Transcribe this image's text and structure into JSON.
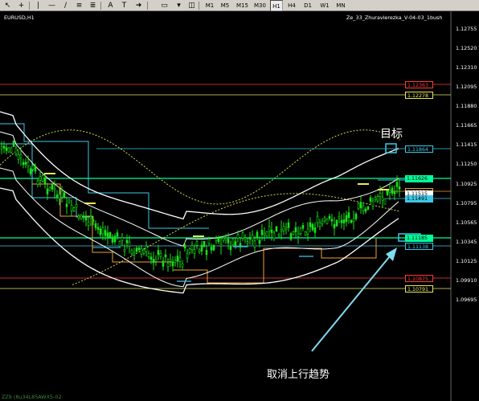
{
  "toolbar": {
    "timeframes": [
      "M1",
      "M5",
      "M15",
      "M30",
      "H1",
      "H4",
      "D1",
      "W1",
      "MN"
    ],
    "active": "H1"
  },
  "chart": {
    "symbol_label": "EURUSD,H1",
    "indicator_label": "Ze_33_Zhuravlerezka_V-04-03_1bush",
    "bottom_label": "ZZ9 (8u34L85AWX5-02"
  },
  "price_axis": {
    "ticks": [
      "1.12755",
      "1.12520",
      "1.12310",
      "1.12095",
      "1.11880",
      "1.11665",
      "1.11415",
      "1.11250",
      "1.10925",
      "1.10795",
      "1.10565",
      "1.10345",
      "1.10125",
      "1.09910",
      "1.09695"
    ]
  },
  "levels": {
    "l1": {
      "price": "1.12363",
      "color": "#ff3b3b"
    },
    "l2": {
      "price": "1.12278",
      "color": "#e8e85a"
    },
    "l3": {
      "price": "1.11864",
      "color": "#3ec7e6"
    },
    "l4": {
      "price": "1.11626",
      "color": "#00ff9a"
    },
    "l5": {
      "price": "1.11534",
      "color": "#f0a030"
    },
    "l6": {
      "price": "1.11515",
      "color": "#ffffff"
    },
    "l7": {
      "price": "1.11491",
      "color": "#3ec7e6"
    },
    "l8": {
      "price": "1.11185",
      "color": "#00ff9a"
    },
    "l9": {
      "price": "1.11138",
      "color": "#3ec7e6"
    },
    "l10": {
      "price": "1.10875",
      "color": "#ff3b3b"
    },
    "l11": {
      "price": "1.10791",
      "color": "#e8e85a"
    }
  },
  "annotations": {
    "target": "目标",
    "cancel": "取消上行趋势"
  }
}
